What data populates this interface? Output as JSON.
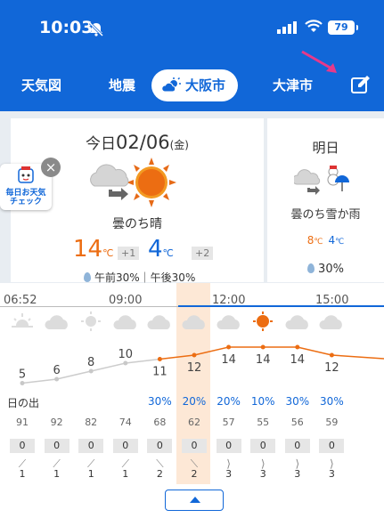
{
  "status_bar": {
    "time": "10:03",
    "battery": "79"
  },
  "nav": {
    "tabs": [
      {
        "label": "天気図"
      },
      {
        "label": "地震"
      },
      {
        "label": "大阪市",
        "active": true
      },
      {
        "label": "大津市"
      }
    ]
  },
  "today": {
    "prefix": "今日",
    "date": "02/06",
    "weekday": "(金)",
    "weather": "曇のち晴",
    "high": "14",
    "high_diff": "+1",
    "low": "4",
    "low_diff": "+2",
    "unit": "℃",
    "pop": "午前30%｜午後30%"
  },
  "tomorrow": {
    "title": "明日",
    "weather": "曇のち雪か雨",
    "high": "8",
    "low": "4",
    "unit": "℃",
    "pop": "30%"
  },
  "badge": {
    "label": "毎日お天気チェック",
    "close": "×"
  },
  "hourly": {
    "time_labels": [
      "06:52",
      "09:00",
      "12:00",
      "15:00"
    ],
    "sunrise_label": "日の出",
    "hours": [
      {
        "icon": "sunrise-icon",
        "temp": "5",
        "pop": "",
        "humidity": "91",
        "rain": "0",
        "wind": "1"
      },
      {
        "icon": "cloud-icon",
        "temp": "6",
        "pop": "",
        "humidity": "92",
        "rain": "0",
        "wind": "1"
      },
      {
        "icon": "sun-faint-icon",
        "temp": "8",
        "pop": "",
        "humidity": "82",
        "rain": "0",
        "wind": "1"
      },
      {
        "icon": "cloud-icon",
        "temp": "10",
        "pop": "",
        "humidity": "74",
        "rain": "0",
        "wind": "1"
      },
      {
        "icon": "cloud-icon",
        "temp": "11",
        "pop": "30%",
        "humidity": "68",
        "rain": "0",
        "wind": "2"
      },
      {
        "icon": "cloud-icon",
        "temp": "12",
        "pop": "20%",
        "humidity": "62",
        "rain": "0",
        "wind": "2"
      },
      {
        "icon": "cloud-icon",
        "temp": "14",
        "pop": "20%",
        "humidity": "57",
        "rain": "0",
        "wind": "3"
      },
      {
        "icon": "sun-icon",
        "temp": "14",
        "pop": "10%",
        "humidity": "55",
        "rain": "0",
        "wind": "3"
      },
      {
        "icon": "cloud-icon",
        "temp": "14",
        "pop": "30%",
        "humidity": "56",
        "rain": "0",
        "wind": "3"
      },
      {
        "icon": "cloud-icon",
        "temp": "12",
        "pop": "30%",
        "humidity": "59",
        "rain": "0",
        "wind": "3"
      }
    ]
  },
  "colors": {
    "brand": "#1167d8",
    "high": "#ec6d12",
    "low": "#1167d8",
    "now_highlight": "#fde8d6"
  }
}
